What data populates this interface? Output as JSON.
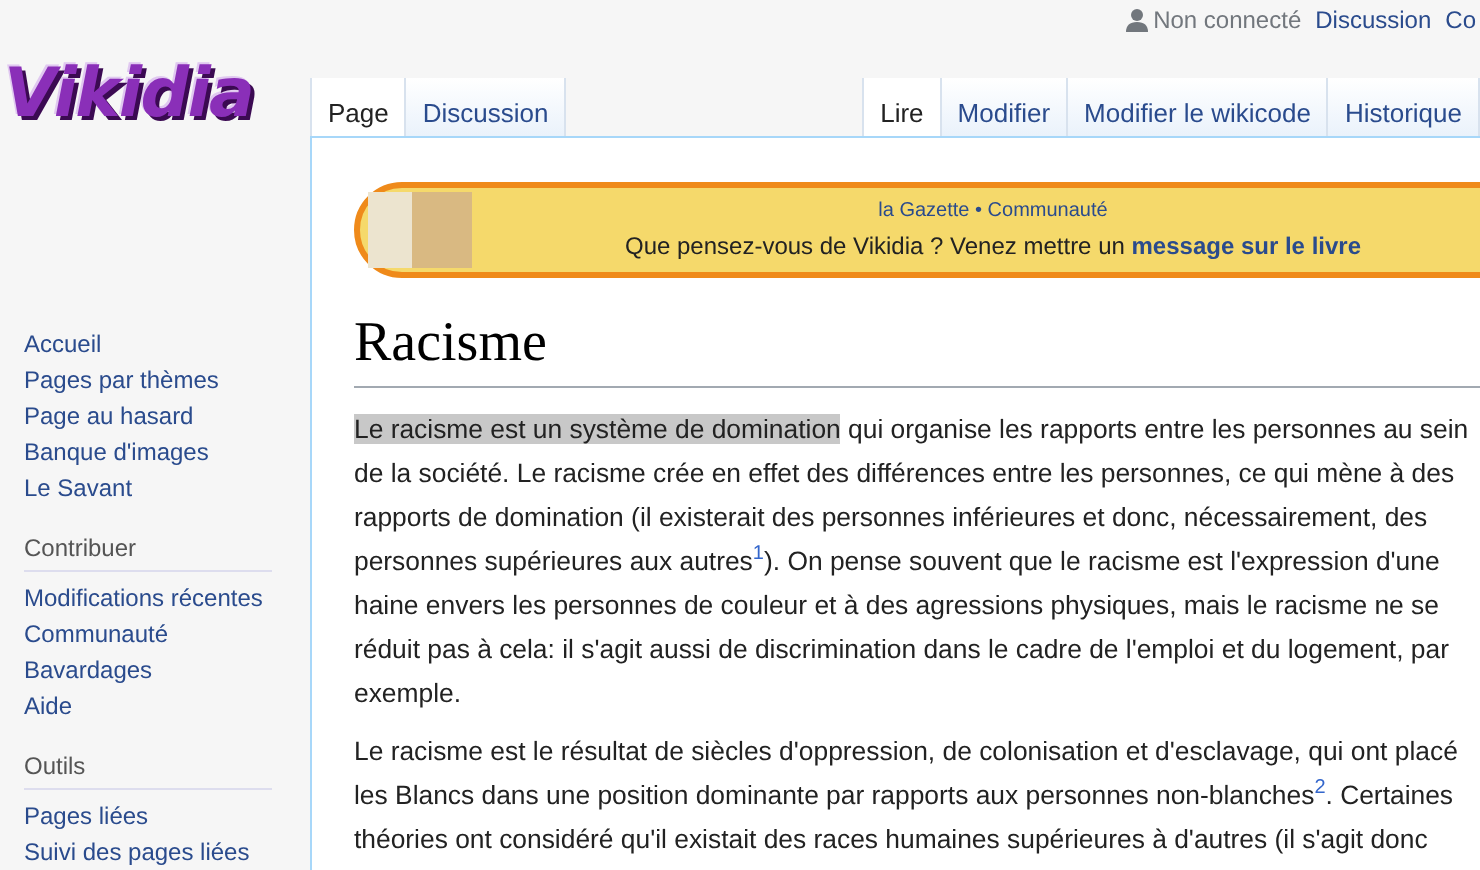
{
  "personal": {
    "status": "Non connecté",
    "links": [
      "Discussion",
      "Co"
    ]
  },
  "logo": {
    "text": "Vikidia"
  },
  "left_tabs": [
    {
      "label": "Page",
      "selected": true
    },
    {
      "label": "Discussion",
      "selected": false
    }
  ],
  "right_tabs": [
    {
      "label": "Lire",
      "selected": true
    },
    {
      "label": "Modifier",
      "selected": false
    },
    {
      "label": "Modifier le wikicode",
      "selected": false
    },
    {
      "label": "Historique",
      "selected": false
    }
  ],
  "banner": {
    "heading": "la Gazette • Communauté",
    "message": "Que pensez-vous de Vikidia ? Venez mettre un",
    "link": "message sur le livre"
  },
  "sidebar": {
    "main": [
      "Accueil",
      "Pages par thèmes",
      "Page au hasard",
      "Banque d'images",
      "Le Savant"
    ],
    "sections": [
      {
        "title": "Contribuer",
        "items": [
          "Modifications récentes",
          "Communauté",
          "Bavardages",
          "Aide"
        ]
      },
      {
        "title": "Outils",
        "items": [
          "Pages liées",
          "Suivi des pages liées"
        ]
      }
    ]
  },
  "title": "Racisme",
  "paragraphs": [
    [
      {
        "kind": "highlight",
        "text": "Le racisme est un système de domination"
      },
      {
        "kind": "plain",
        "text": " qui organise les rapports entre les personnes au sein de la société. Le racisme crée en effet des différences entre les personnes, ce qui mène à des rapports de domination (il existerait des personnes inférieures et donc, nécessairement, des personnes supérieures aux autres"
      },
      {
        "kind": "ref",
        "text": "1"
      },
      {
        "kind": "plain",
        "text": "). On pense souvent que le racisme est l'expression d'une haine envers les personnes de couleur et à des agressions physiques, mais le racisme ne se réduit pas à cela: il s'agit aussi de discrimination dans le cadre de l'emploi et du logement, par exemple."
      }
    ],
    [
      {
        "kind": "plain",
        "text": "Le racisme est le résultat de siècles d'oppression, de colonisation et d'esclavage, qui ont placé les Blancs dans une position dominante par rapports aux personnes non-blanches"
      },
      {
        "kind": "ref",
        "text": "2"
      },
      {
        "kind": "plain",
        "text": ". Certaines théories ont considéré qu'il existait des races humaines supérieures à d'autres (il s'agit donc"
      }
    ]
  ]
}
